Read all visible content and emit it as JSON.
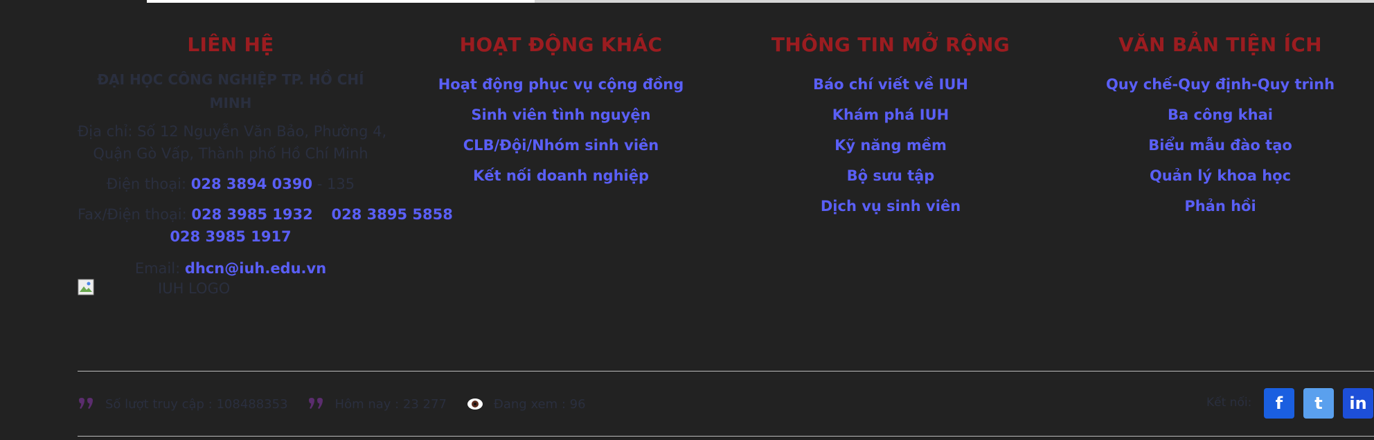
{
  "contact": {
    "title": "LIÊN HỆ",
    "school_name": "ĐẠI HỌC CÔNG NGHIỆP TP. HỒ CHÍ MINH",
    "address_line1": "Địa chỉ: Số 12 Nguyễn Văn Bảo, Phường 4,",
    "address_line2": "Quận Gò Vấp, Thành phố Hồ Chí Minh",
    "phone_label": "Điện thoại:",
    "phone": "028 3894 0390",
    "phone_ext": " - 135",
    "fax_label": "Fax/Điện thoại:",
    "fax1": "028 3985 1932",
    "fax2": "028 3895 5858",
    "fax3": "028 3985 1917",
    "email_label": "Email:",
    "email": "dhcn@iuh.edu.vn",
    "logo_alt": "IUH LOGO"
  },
  "other": {
    "title": "HOẠT ĐỘNG KHÁC",
    "links": [
      "Hoạt động phục vụ cộng đồng",
      "Sinh viên tình nguyện",
      "CLB/Đội/Nhóm sinh viên",
      "Kết nối doanh nghiệp"
    ]
  },
  "info": {
    "title": "THÔNG TIN MỞ RỘNG",
    "links": [
      "Báo chí viết về IUH",
      "Khám phá IUH",
      "Kỹ năng mềm",
      "Bộ sưu tập",
      "Dịch vụ sinh viên"
    ]
  },
  "docs": {
    "title": "VĂN BẢN TIỆN ÍCH",
    "links": [
      "Quy chế-Quy định-Quy trình",
      "Ba công khai",
      "Biểu mẫu đào tạo",
      "Quản lý khoa học",
      "Phản hồi"
    ]
  },
  "stats": {
    "total_visits": "Số lượt truy cập : 108488353",
    "today": "Hôm nay : 23 277",
    "online": "Đang xem : 96"
  },
  "follow_label": "Kết nối:",
  "social": {
    "facebook": "f",
    "twitter": "t",
    "linkedin": "in"
  },
  "colors": {
    "background": "#222222",
    "heading": "#9b1c20",
    "link": "#5a5ff6",
    "facebook": "#1a5fe0",
    "twitter": "#5aa0ee",
    "linkedin": "#1d4fd8"
  }
}
